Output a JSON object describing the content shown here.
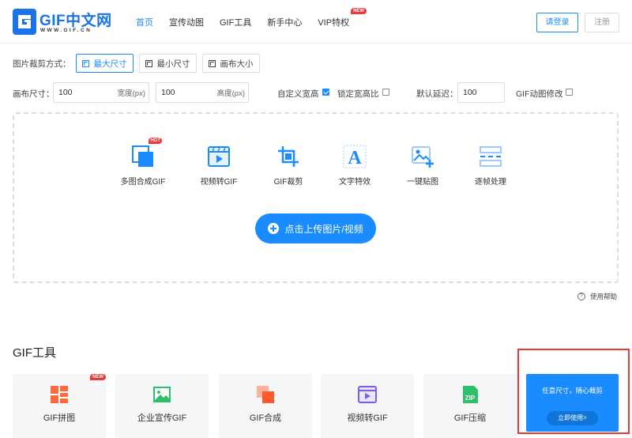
{
  "brand": {
    "name": "GIF中文网",
    "domain": "WWW.GIF.CN",
    "accent": "#1a8cff"
  },
  "nav": {
    "items": [
      "首页",
      "宣传动图",
      "GIF工具",
      "新手中心",
      "VIP特权"
    ],
    "vip_badge": "NEW",
    "login": "请登录",
    "register": "注册"
  },
  "crop": {
    "label": "图片裁剪方式：",
    "modes": [
      "最大尺寸",
      "最小尺寸",
      "画布大小"
    ],
    "selected": "最大尺寸"
  },
  "canvas": {
    "label": "画布尺寸：",
    "width_value": "100",
    "width_unit": "宽度(px)",
    "height_value": "100",
    "height_unit": "高度(px)",
    "custom_ratio_label": "自定义宽高",
    "custom_ratio_checked": true,
    "lock_ratio_label": "锁定宽高比",
    "lock_ratio_checked": false,
    "delay_label": "默认延迟：",
    "delay_value": "100",
    "gif_modify_label": "GIF动图修改",
    "gif_modify_checked": false
  },
  "upload": {
    "tools": [
      {
        "label": "多图合成GIF",
        "icon": "multi-image-icon",
        "hot": "HOT"
      },
      {
        "label": "视频转GIF",
        "icon": "video-icon"
      },
      {
        "label": "GIF裁剪",
        "icon": "crop-icon"
      },
      {
        "label": "文字特效",
        "icon": "text-effect-icon"
      },
      {
        "label": "一键贴图",
        "icon": "image-add-icon"
      },
      {
        "label": "逐帧处理",
        "icon": "frames-icon"
      }
    ],
    "button": "点击上传图片/视频"
  },
  "help": {
    "label": "使用帮助"
  },
  "gif_tools": {
    "title": "GIF工具",
    "cards": [
      {
        "label": "GIF拼图",
        "icon": "collage-icon",
        "badge": "NEW"
      },
      {
        "label": "企业宣传GIF",
        "icon": "picture-icon"
      },
      {
        "label": "GIF合成",
        "icon": "merge-icon"
      },
      {
        "label": "视频转GIF",
        "icon": "video-icon"
      },
      {
        "label": "GIF压缩",
        "icon": "zip-icon"
      }
    ],
    "promo": {
      "text": "任意尺寸，随心裁剪",
      "button": "立即使用>"
    }
  }
}
